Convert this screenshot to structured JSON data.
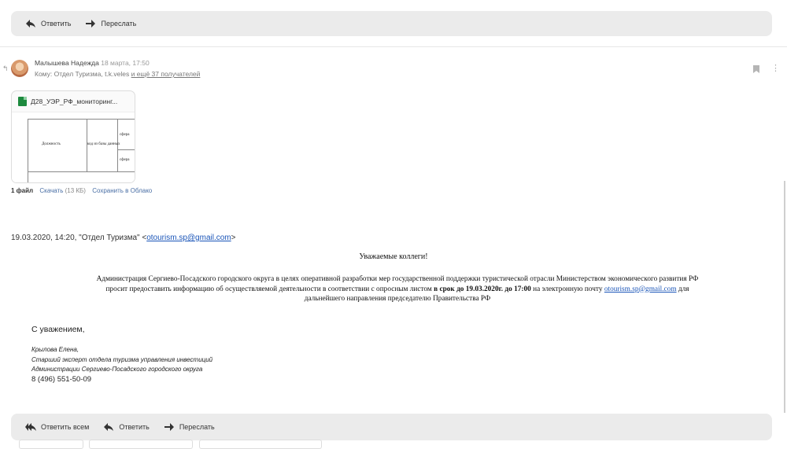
{
  "top_toolbar": {
    "reply_label": "Ответить",
    "forward_label": "Переслать"
  },
  "message": {
    "sender_name": "Малышева Надежда",
    "date": "18 марта, 17:50",
    "to_prefix": "Кому: Отдел Туризма, t.k.veles",
    "to_more": "и ещё 37 получателей"
  },
  "attachment": {
    "file_name": "Д28_УЭР_РФ_мониторинг...",
    "preview_label_1": "Должность",
    "preview_label_2": "код из базы данных",
    "preview_label_3": "сфера",
    "preview_label_4": "сфера",
    "count_label": "1 файл",
    "download_label": "Скачать",
    "size_label": "(13 КБ)",
    "save_cloud_label": "Сохранить в Облако"
  },
  "quote": {
    "header_prefix": "19.03.2020, 14:20, \"Отдел Туризма\" <",
    "header_email": "otourism.sp@gmail.com",
    "header_suffix": ">"
  },
  "letter": {
    "greeting": "Уважаемые коллеги!",
    "line1": "Администрация Сергиево-Посадского городского округа в целях оперативной разработки мер государственной поддержки туристической отрасли Министерством экономического развития РФ",
    "line2_a": "просит предоставить информацию об осуществляемой деятельности в соответствии с опросным листом ",
    "line2_bold": "в срок до 19.03.2020г. до 17:00",
    "line2_b": " на электронную почту ",
    "line2_email": "otourism.sp@gmail.com",
    "line2_c": " для",
    "line3": "дальнейшего направления председателю Правительства РФ"
  },
  "signature": {
    "regards": "С уважением,",
    "name": "Крылова Елена,",
    "position": "Старший эксперт отдела туризма управления инвестиций",
    "org": "Администрации Сергиево-Посадского городского округа",
    "phone": "8 (496) 551-50-09"
  },
  "bottom_toolbar": {
    "reply_all_label": "Ответить всем",
    "reply_label": "Ответить",
    "forward_label": "Переслать"
  },
  "colors": {
    "toolbar_bg": "#ebebeb",
    "link": "#1a55b8"
  }
}
